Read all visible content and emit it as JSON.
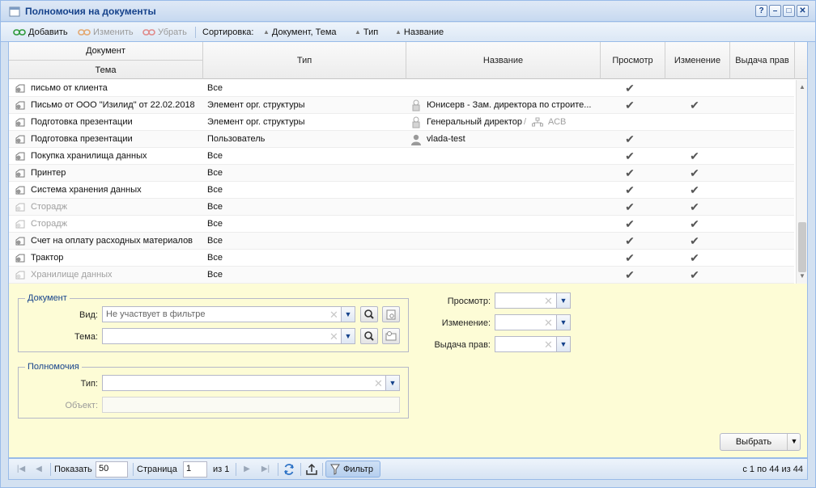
{
  "window": {
    "title": "Полномочия на документы",
    "buttons": [
      "?",
      "–",
      "□",
      "✕"
    ]
  },
  "toolbar": {
    "add_label": "Добавить",
    "edit_label": "Изменить",
    "remove_label": "Убрать",
    "sort_label": "Сортировка:",
    "sort_keys": [
      "Документ, Тема",
      "Тип",
      "Название"
    ]
  },
  "grid": {
    "columns": {
      "document": "Документ",
      "topic": "Тема",
      "type": "Тип",
      "name": "Название",
      "view": "Просмотр",
      "edit": "Изменение",
      "grant": "Выдача прав"
    },
    "rows": [
      {
        "topic": "письмо от клиента",
        "type": "Все",
        "name": "",
        "view": true,
        "edit": false,
        "muted": false
      },
      {
        "topic": "Письмо от ООО \"Изилид\" от 22.02.2018",
        "type": "Элемент орг. структуры",
        "name": "Юнисерв - Зам. директора по строите...",
        "name_icon": "person-badge-icon",
        "view": true,
        "edit": true,
        "muted": false
      },
      {
        "topic": "Подготовка презентации",
        "type": "Элемент орг. структуры",
        "name": "Генеральный директор",
        "name_extra": "АСВ",
        "name_icon": "person-badge-icon",
        "view": false,
        "edit": false,
        "muted": false
      },
      {
        "topic": "Подготовка презентации",
        "type": "Пользователь",
        "name": "vlada-test",
        "name_icon": "user-icon",
        "view": true,
        "edit": false,
        "muted": false
      },
      {
        "topic": "Покупка хранилища данных",
        "type": "Все",
        "name": "",
        "view": true,
        "edit": true,
        "muted": false
      },
      {
        "topic": "Принтер",
        "type": "Все",
        "name": "",
        "view": true,
        "edit": true,
        "muted": false
      },
      {
        "topic": "Система хранения данных",
        "type": "Все",
        "name": "",
        "view": true,
        "edit": true,
        "muted": false
      },
      {
        "topic": "Сторадж",
        "type": "Все",
        "name": "",
        "view": true,
        "edit": true,
        "muted": true
      },
      {
        "topic": "Сторадж",
        "type": "Все",
        "name": "",
        "view": true,
        "edit": true,
        "muted": true
      },
      {
        "topic": "Счет на оплату расходных материалов",
        "type": "Все",
        "name": "",
        "view": true,
        "edit": true,
        "muted": false
      },
      {
        "topic": "Трактор",
        "type": "Все",
        "name": "",
        "view": true,
        "edit": true,
        "muted": false
      },
      {
        "topic": "Хранилище данных",
        "type": "Все",
        "name": "",
        "view": true,
        "edit": true,
        "muted": true
      }
    ]
  },
  "filter": {
    "document_group": "Документ",
    "kind_label": "Вид:",
    "kind_value": "Не участвует в фильтре",
    "topic_label": "Тема:",
    "topic_value": "",
    "authority_group": "Полномочия",
    "type_label": "Тип:",
    "type_value": "",
    "object_label": "Объект:",
    "view_label": "Просмотр:",
    "edit_label": "Изменение:",
    "grant_label": "Выдача прав:",
    "select_button": "Выбрать"
  },
  "pager": {
    "show_label": "Показать",
    "page_size": "50",
    "page_label": "Страница",
    "page_value": "1",
    "of_label": "из 1",
    "filter_label": "Фильтр",
    "summary": "с 1 по 44 из 44"
  },
  "colors": {
    "accent": "#15428b",
    "filter_bg": "#fdfcd6",
    "border": "#99bbe8"
  }
}
